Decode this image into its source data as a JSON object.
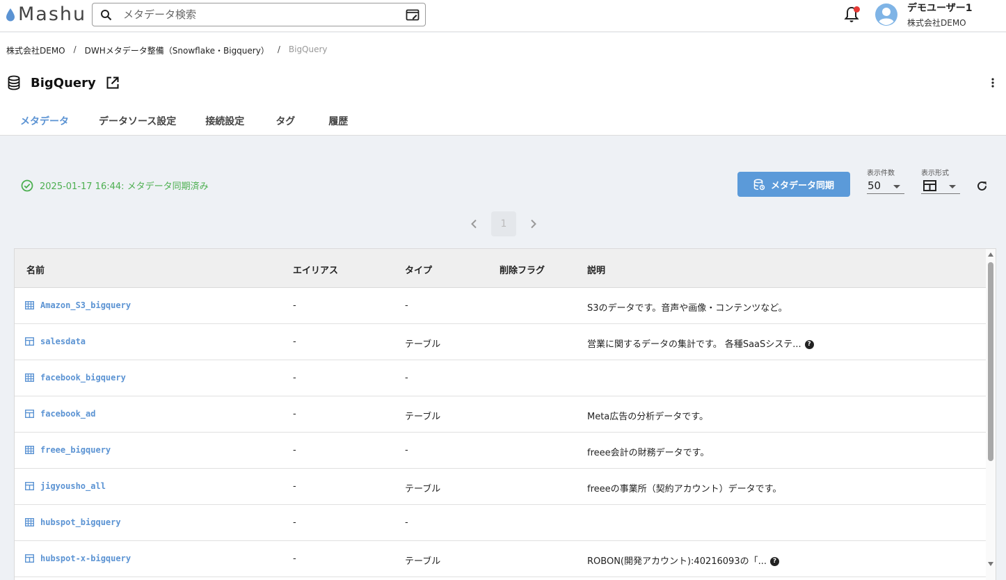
{
  "app": {
    "logo_text": "Mashu",
    "brand_color": "#5b93d3"
  },
  "search": {
    "placeholder": "メタデータ検索",
    "value": ""
  },
  "user": {
    "name": "デモユーザー1",
    "company": "株式会社DEMO",
    "has_notification": true
  },
  "breadcrumb": [
    {
      "label": "株式会社DEMO"
    },
    {
      "label": "DWHメタデータ整備（Snowflake・Bigquery）"
    },
    {
      "label": "BigQuery"
    }
  ],
  "breadcrumb_separator": "/",
  "page": {
    "title": "BigQuery",
    "icon": "database-icon"
  },
  "tabs": [
    {
      "label": "メタデータ",
      "active": true
    },
    {
      "label": "データソース設定",
      "active": false
    },
    {
      "label": "接続設定",
      "active": false
    },
    {
      "label": "タグ",
      "active": false
    },
    {
      "label": "履歴",
      "active": false
    }
  ],
  "sync": {
    "status_text": "2025-01-17 16:44: メタデータ同期済み",
    "status_color": "#4caf50",
    "button_label": "メタデータ同期"
  },
  "controls": {
    "per_page_label": "表示件数",
    "per_page_value": "50",
    "view_label": "表示形式",
    "view_icon": "table-grid-icon"
  },
  "pagination": {
    "current_page": "1"
  },
  "table": {
    "columns": [
      "名前",
      "エイリアス",
      "タイプ",
      "削除フラグ",
      "説明"
    ],
    "rows": [
      {
        "icon": "grid-table-icon",
        "name": "Amazon_S3_bigquery",
        "alias": "-",
        "type": "-",
        "deleted": "",
        "description": "S3のデータです。音声や画像・コンテンツなど。",
        "help": false
      },
      {
        "icon": "table-icon",
        "name": "salesdata",
        "alias": "-",
        "type": "テーブル",
        "deleted": "",
        "description": "営業に関するデータの集計です。 各種SaaSシステ...",
        "help": true
      },
      {
        "icon": "grid-table-icon",
        "name": "facebook_bigquery",
        "alias": "-",
        "type": "-",
        "deleted": "",
        "description": "",
        "help": false
      },
      {
        "icon": "table-icon",
        "name": "facebook_ad",
        "alias": "-",
        "type": "テーブル",
        "deleted": "",
        "description": "Meta広告の分析データです。",
        "help": false
      },
      {
        "icon": "grid-table-icon",
        "name": "freee_bigquery",
        "alias": "-",
        "type": "-",
        "deleted": "",
        "description": "freee会計の財務データです。",
        "help": false
      },
      {
        "icon": "table-icon",
        "name": "jigyousho_all",
        "alias": "-",
        "type": "テーブル",
        "deleted": "",
        "description": "freeeの事業所（契約アカウント）データです。",
        "help": false
      },
      {
        "icon": "grid-table-icon",
        "name": "hubspot_bigquery",
        "alias": "-",
        "type": "-",
        "deleted": "",
        "description": "",
        "help": false
      },
      {
        "icon": "table-icon",
        "name": "hubspot-x-bigquery",
        "alias": "-",
        "type": "テーブル",
        "deleted": "",
        "description": "ROBON(開発アカウント):40216093の「...",
        "help": true
      }
    ]
  }
}
